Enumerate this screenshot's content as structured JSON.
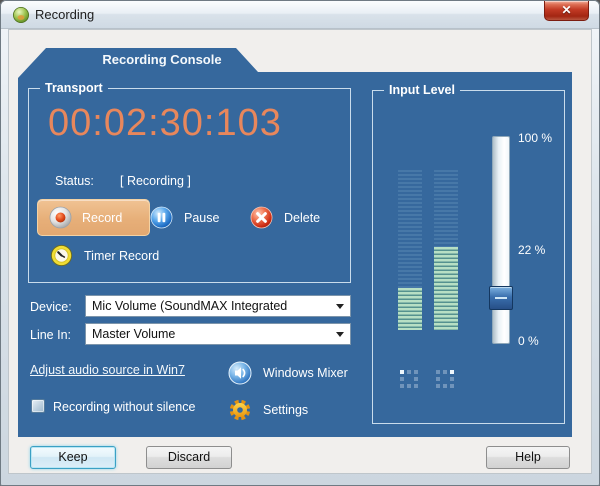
{
  "window": {
    "title": "Recording",
    "close_glyph": "✕"
  },
  "tab": {
    "label": "Recording Console"
  },
  "transport": {
    "group_label": "Transport",
    "timer": "00:02:30:103",
    "status_label": "Status:",
    "status_value": "[ Recording ]",
    "record_label": "Record",
    "pause_label": "Pause",
    "delete_label": "Delete",
    "timer_record_label": "Timer Record"
  },
  "device": {
    "label": "Device:",
    "value": "Mic Volume (SoundMAX Integrated"
  },
  "line_in": {
    "label": "Line In:",
    "value": "Master Volume"
  },
  "options": {
    "adjust_link": "Adjust audio source in Win7",
    "silence": {
      "label": "Recording without silence",
      "checked": false
    },
    "mixer_label": "Windows Mixer",
    "settings_label": "Settings"
  },
  "input_level": {
    "group_label": "Input Level",
    "max_label": "100 %",
    "current_label": "22 %",
    "min_label": "0 %",
    "slider_percent": 22,
    "meters": [
      {
        "side": "left",
        "level_percent": 26
      },
      {
        "side": "right",
        "level_percent": 52
      }
    ]
  },
  "footer": {
    "keep": "Keep",
    "discard": "Discard",
    "help": "Help"
  },
  "colors": {
    "panel_blue": "#36689d",
    "timer_orange": "#e8875c",
    "record_button": "#e9b280",
    "meter_green": "#b7dfc4",
    "close_red": "#c23a24"
  }
}
